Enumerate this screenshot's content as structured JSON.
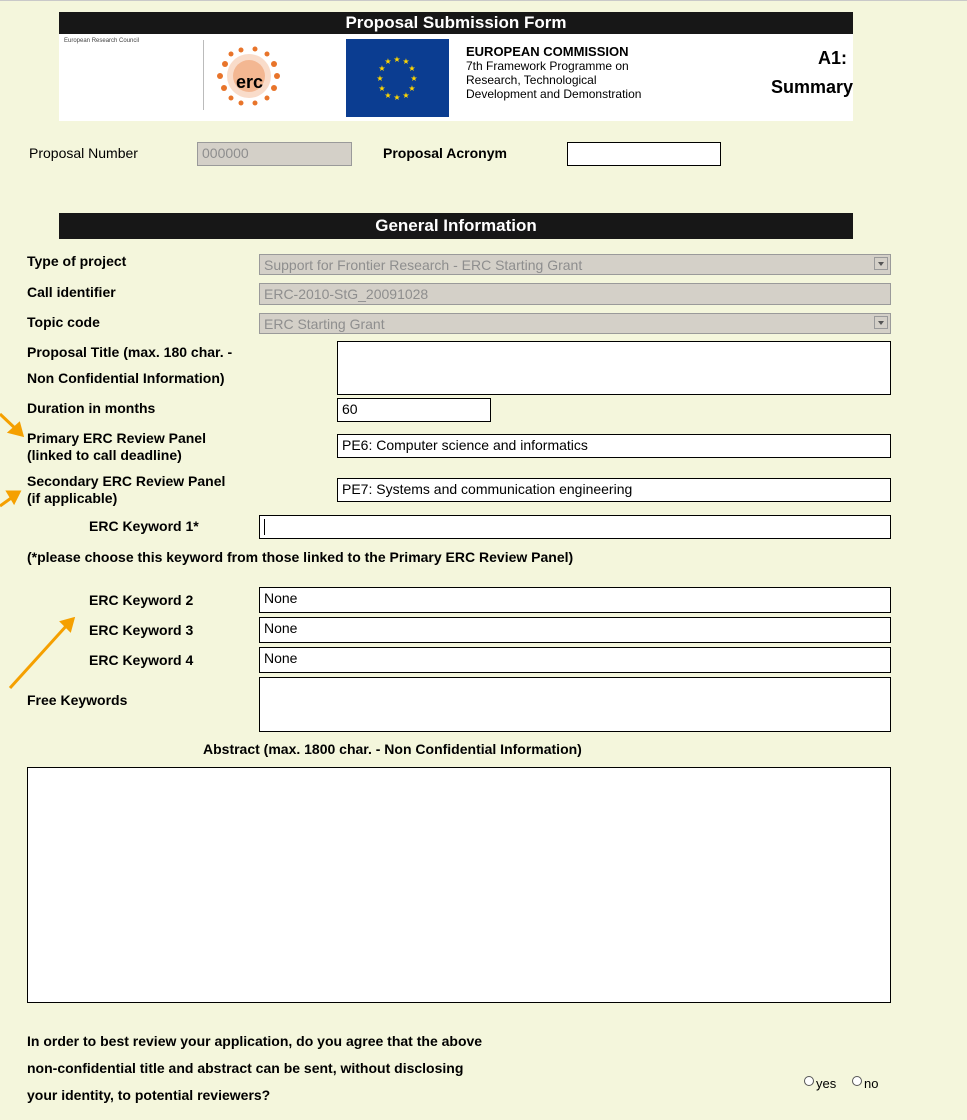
{
  "header": {
    "bar_title": "Proposal Submission Form",
    "erc_council": "European Research Council",
    "erc_logo": "erc",
    "commission": "EUROPEAN COMMISSION",
    "programme_lines": [
      "7th Framework Programme on",
      "Research, Technological",
      "Development and Demonstration"
    ],
    "section_code": "A1:",
    "section_name": "Summary"
  },
  "proposal": {
    "number_label": "Proposal Number",
    "number_value": "000000",
    "acronym_label": "Proposal Acronym",
    "acronym_value": ""
  },
  "general_info": {
    "title": "General Information",
    "type_label": "Type of project",
    "type_value": "Support for Frontier Research - ERC Starting Grant",
    "call_label": "Call identifier",
    "call_value": "ERC-2010-StG_20091028",
    "topic_label": "Topic code",
    "topic_value": "ERC Starting Grant",
    "title_label_1": "Proposal Title  (max. 180 char. -",
    "title_label_2": "Non Confidential Information)",
    "title_value": "",
    "duration_label": "Duration in months",
    "duration_value": "60",
    "primary_label_1": "Primary ERC Review Panel",
    "primary_label_2": "(linked to call deadline)",
    "primary_value": "PE6: Computer science and informatics",
    "secondary_label_1": "Secondary ERC Review Panel",
    "secondary_label_2": "(if applicable)",
    "secondary_value": "PE7: Systems and communication engineering",
    "keyword1_label": "ERC Keyword 1*",
    "keyword1_value": "",
    "keyword_note": "(*please choose this keyword from those linked to the Primary ERC Review Panel)",
    "keyword2_label": "ERC Keyword 2",
    "keyword2_value": "None",
    "keyword3_label": "ERC Keyword 3",
    "keyword3_value": "None",
    "keyword4_label": "ERC Keyword 4",
    "keyword4_value": "None",
    "free_keywords_label": "Free Keywords",
    "free_keywords_value": "",
    "abstract_label": "Abstract (max. 1800 char. - Non Confidential Information)",
    "abstract_value": ""
  },
  "consent": {
    "question_lines": [
      "In order to best review your application, do you agree that the above",
      "non-confidential title and abstract can be sent, without disclosing",
      "your identity, to potential reviewers?"
    ],
    "yes_label": "yes",
    "no_label": "no"
  },
  "colors": {
    "page_bg": "#f4f6dc",
    "bar_bg": "#171717",
    "annotation_arrow": "#f5a000",
    "eu_flag_blue": "#0b3d91",
    "eu_star": "#ffd700",
    "erc_orange": "#e8742a"
  }
}
